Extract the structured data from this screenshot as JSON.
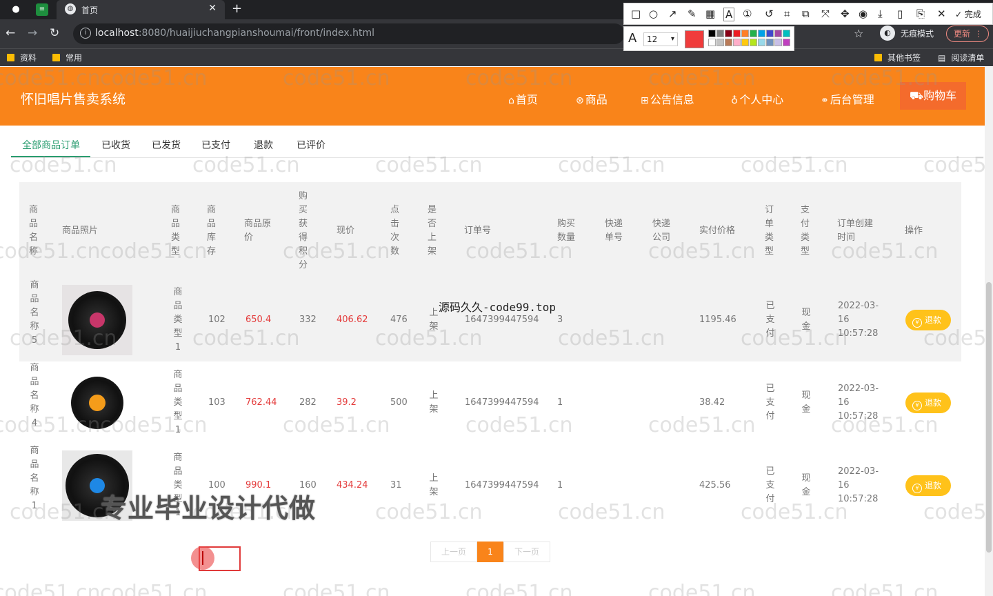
{
  "browser": {
    "tab_title": "首页",
    "url_host": "localhost",
    "url_rest": ":8080/huaijiuchangpianshoumai/front/index.html",
    "incognito_label": "无痕模式",
    "update_label": "更新",
    "bookmarks": [
      "资料",
      "常用"
    ],
    "bookmarks_right": [
      "其他书签",
      "阅读清单"
    ]
  },
  "screenshot_tool": {
    "done_label": "完成",
    "font_size": "12",
    "current_color": "#f03c3c",
    "palette": [
      "#000000",
      "#7f7f7f",
      "#880015",
      "#ed1c24",
      "#ff7f27",
      "#22b14c",
      "#00a2e8",
      "#3f48cc",
      "#a349a4",
      "#00c0c0",
      "#ffffff",
      "#c3c3c3",
      "#b97a57",
      "#ffaec9",
      "#ffc90e",
      "#b5e61d",
      "#99d9ea",
      "#7092be",
      "#c8bfe7",
      "#c040c0"
    ]
  },
  "site": {
    "title": "怀旧唱片售卖系统",
    "nav": {
      "home": "首页",
      "goods": "商品",
      "notice": "公告信息",
      "profile": "个人中心",
      "admin": "后台管理",
      "cart": "购物车"
    },
    "accent_color": "#f9841a"
  },
  "tabs": [
    "全部商品订单",
    "已收货",
    "已发货",
    "已支付",
    "退款",
    "已评价"
  ],
  "table": {
    "headers": {
      "name": "商品名称",
      "photo": "商品照片",
      "type": "商品类型",
      "stock": "商品库存",
      "orig_price": "商品原价",
      "points": "购买获得积分",
      "price": "现价",
      "clicks": "点击次数",
      "listed": "是否上架",
      "order_no": "订单号",
      "qty": "购买数量",
      "tracking": "快递单号",
      "courier": "快递公司",
      "paid": "实付价格",
      "order_type": "订单类型",
      "pay_type": "支付类型",
      "created": "订单创建时间",
      "action": "操作"
    },
    "rows": [
      {
        "name": "商品名称5",
        "type": "商品类型1",
        "stock": "102",
        "orig_price": "650.4",
        "points": "332",
        "price": "406.62",
        "clicks": "476",
        "listed": "上架",
        "order_no": "1647399447594",
        "qty": "3",
        "tracking": "",
        "courier": "",
        "paid": "1195.46",
        "order_type": "已支付",
        "pay_type": "现金",
        "created_date": "2022-03-16",
        "created_time": "10:57:28",
        "action": "退款",
        "disc": "pink"
      },
      {
        "name": "商品名称4",
        "type": "商品类型1",
        "stock": "103",
        "orig_price": "762.44",
        "points": "282",
        "price": "39.2",
        "clicks": "500",
        "listed": "上架",
        "order_no": "1647399447594",
        "qty": "1",
        "tracking": "",
        "courier": "",
        "paid": "38.42",
        "order_type": "已支付",
        "pay_type": "现金",
        "created_date": "2022-03-16",
        "created_time": "10:57:28",
        "action": "退款",
        "disc": "orange"
      },
      {
        "name": "商品名称1",
        "type": "商品类型1",
        "stock": "100",
        "orig_price": "990.1",
        "points": "160",
        "price": "434.24",
        "clicks": "31",
        "listed": "上架",
        "order_no": "1647399447594",
        "qty": "1",
        "tracking": "",
        "courier": "",
        "paid": "425.56",
        "order_type": "已支付",
        "pay_type": "现金",
        "created_date": "2022-03-16",
        "created_time": "10:57:28",
        "action": "退款",
        "disc": "blue"
      }
    ]
  },
  "pager": {
    "prev": "上一页",
    "current": "1",
    "next": "下一页"
  },
  "overlays": {
    "watermark": "code51.cn",
    "center_note": "源码久久-code99.top",
    "stamp": "专业毕业设计代做"
  }
}
